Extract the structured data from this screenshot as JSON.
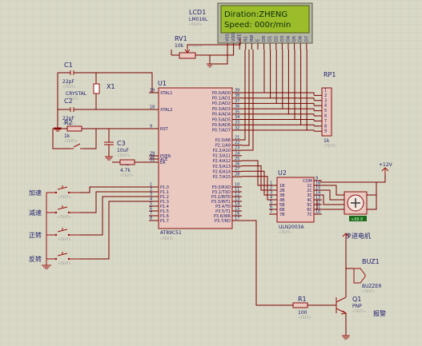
{
  "lcd": {
    "ref": "LCD1",
    "model": "LM016L",
    "line1": "Diration:ZHENG",
    "line2": "Speed: 000r/min",
    "text_tag": "<TEXT>",
    "pins": [
      "VSS",
      "VDD",
      "VEE",
      "RS",
      "RW",
      "E",
      "D0",
      "D1",
      "D2",
      "D3",
      "D4",
      "D5",
      "D6",
      "D7"
    ]
  },
  "rv1": {
    "ref": "RV1",
    "value": "10k",
    "text_tag": "<TEXT>"
  },
  "mcu": {
    "ref": "U1",
    "model": "AT89C51",
    "text_tag": "<TEXT>",
    "left_pins": [
      {
        "num": "19",
        "name": "XTAL1"
      },
      {
        "num": "18",
        "name": "XTAL2"
      },
      {
        "num": "9",
        "name": "RST"
      },
      {
        "num": "29",
        "name": "PSEN"
      },
      {
        "num": "30",
        "name": "ALE"
      },
      {
        "num": "31",
        "name": "EA"
      },
      {
        "num": "1",
        "name": "P1.0"
      },
      {
        "num": "2",
        "name": "P1.1"
      },
      {
        "num": "3",
        "name": "P1.2"
      },
      {
        "num": "4",
        "name": "P1.3"
      },
      {
        "num": "5",
        "name": "P1.4"
      },
      {
        "num": "6",
        "name": "P1.5"
      },
      {
        "num": "7",
        "name": "P1.6"
      },
      {
        "num": "8",
        "name": "P1.7"
      }
    ],
    "right_pins": [
      {
        "num": "39",
        "name": "P0.0/AD0"
      },
      {
        "num": "38",
        "name": "P0.1/AD1"
      },
      {
        "num": "37",
        "name": "P0.2/AD2"
      },
      {
        "num": "36",
        "name": "P0.3/AD3"
      },
      {
        "num": "35",
        "name": "P0.4/AD4"
      },
      {
        "num": "34",
        "name": "P0.5/AD5"
      },
      {
        "num": "33",
        "name": "P0.6/AD6"
      },
      {
        "num": "32",
        "name": "P0.7/AD7"
      },
      {
        "num": "21",
        "name": "P2.0/A8"
      },
      {
        "num": "22",
        "name": "P2.1/A9"
      },
      {
        "num": "23",
        "name": "P2.2/A10"
      },
      {
        "num": "24",
        "name": "P2.3/A11"
      },
      {
        "num": "25",
        "name": "P2.4/A12"
      },
      {
        "num": "26",
        "name": "P2.5/A13"
      },
      {
        "num": "27",
        "name": "P2.6/A14"
      },
      {
        "num": "28",
        "name": "P2.7/A15"
      },
      {
        "num": "10",
        "name": "P3.0/RXD"
      },
      {
        "num": "11",
        "name": "P3.1/TXD"
      },
      {
        "num": "12",
        "name": "P3.2/INT0"
      },
      {
        "num": "13",
        "name": "P3.3/INT1"
      },
      {
        "num": "14",
        "name": "P3.4/T0"
      },
      {
        "num": "15",
        "name": "P3.5/T1"
      },
      {
        "num": "16",
        "name": "P3.6/WR"
      },
      {
        "num": "17",
        "name": "P3.7/RD"
      }
    ]
  },
  "c1": {
    "ref": "C1",
    "value": "22pF",
    "text_tag": "<TEXT>"
  },
  "c2": {
    "ref": "C2",
    "value": "22pF",
    "text_tag": "<TEXT>"
  },
  "x1": {
    "ref": "X1",
    "value": "CRYSTAL",
    "text_tag": "<TEXT>"
  },
  "c3": {
    "ref": "C3",
    "value": "10uF",
    "text_tag": "<TEXT>"
  },
  "r2": {
    "ref": "R2",
    "value": "1k",
    "text_tag": "<TEXT>"
  },
  "r3": {
    "ref": "R3",
    "value": "4.7k",
    "text_tag": "<TEXT>"
  },
  "r1": {
    "ref": "R1",
    "value": "100",
    "text_tag": "<TEXT>"
  },
  "rp1": {
    "ref": "RP1",
    "value": "1k",
    "text_tag": "<TEXT>",
    "pins": [
      "1",
      "2",
      "3",
      "4",
      "5",
      "6",
      "7",
      "8",
      "9"
    ]
  },
  "u2": {
    "ref": "U2",
    "model": "ULN2003A",
    "text_tag": "<TEXT>",
    "left_pins": [
      {
        "num": "1",
        "name": "1B"
      },
      {
        "num": "2",
        "name": "2B"
      },
      {
        "num": "3",
        "name": "3B"
      },
      {
        "num": "4",
        "name": "4B"
      },
      {
        "num": "5",
        "name": "5B"
      },
      {
        "num": "6",
        "name": "6B"
      },
      {
        "num": "7",
        "name": "7B"
      }
    ],
    "right_pins": [
      {
        "num": "9",
        "name": "COM"
      },
      {
        "num": "16",
        "name": "1C"
      },
      {
        "num": "15",
        "name": "2C"
      },
      {
        "num": "14",
        "name": "3C"
      },
      {
        "num": "13",
        "name": "4C"
      },
      {
        "num": "12",
        "name": "5C"
      },
      {
        "num": "11",
        "name": "6C"
      },
      {
        "num": "10",
        "name": "7C"
      }
    ]
  },
  "motor": {
    "speed_display": "+88.8",
    "label": "步进电机"
  },
  "power": {
    "label": "+12V"
  },
  "buzzer": {
    "ref": "BUZ1",
    "model": "BUZZER",
    "text_tag": "<TEXT>",
    "label": "报警"
  },
  "q1": {
    "ref": "Q1",
    "model": "PNP",
    "text_tag": "<TEXT>"
  },
  "buttons": [
    {
      "label": "加速"
    },
    {
      "label": "减速"
    },
    {
      "label": "正转"
    },
    {
      "label": "反转"
    }
  ],
  "colors": {
    "background": "#d9d8c6",
    "grid": "#c8c7b4",
    "wire": "#7a0000",
    "component": "#9b1010",
    "fill": "#e9c9c0",
    "lcd_screen": "#9bbd2a",
    "lcd_text": "#0e2b0e",
    "label": "#1c1c6e"
  }
}
